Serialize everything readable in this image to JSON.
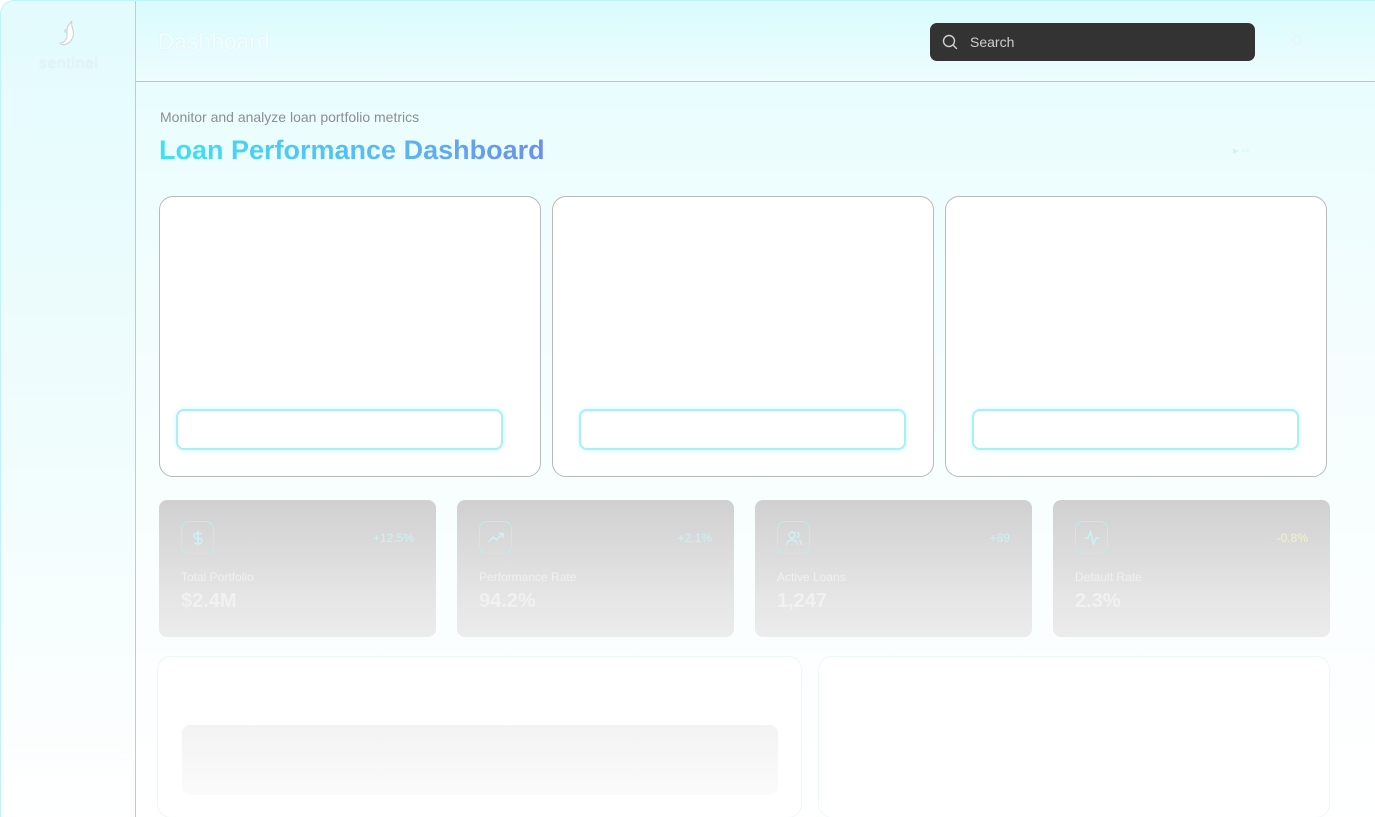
{
  "brand": {
    "logo_text": "sentinel"
  },
  "topbar": {
    "title": "Dashboard"
  },
  "search": {
    "placeholder": "Search"
  },
  "header": {
    "subtitle": "Monitor and analyze loan portfolio metrics",
    "title": "Loan Performance Dashboard"
  },
  "panels": [
    {},
    {},
    {}
  ],
  "stats": [
    {
      "icon": "dollar-icon",
      "change": "+12.5%",
      "label": "Total Portfolio",
      "value": "$2.4M"
    },
    {
      "icon": "trending-up-icon",
      "change": "+2.1%",
      "label": "Performance Rate",
      "value": "94.2%"
    },
    {
      "icon": "users-icon",
      "change": "+89",
      "label": "Active Loans",
      "value": "1,247"
    },
    {
      "icon": "activity-icon",
      "change": "-0.8%",
      "label": "Default Rate",
      "value": "2.3%"
    }
  ],
  "colors": {
    "accent_start": "#3ee2f4",
    "accent_end": "#6d8fe8",
    "search_bg": "#333333",
    "negative_change": "#f2f2c6"
  }
}
